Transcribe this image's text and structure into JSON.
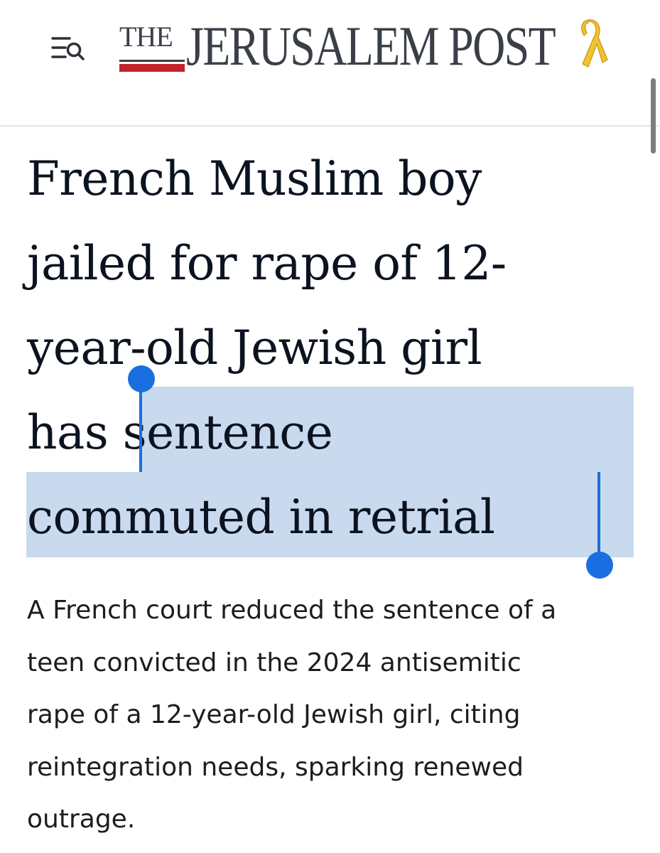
{
  "header": {
    "menu_icon": "menu-search-icon",
    "logo_the": "THE",
    "logo_name": "JERUSALEM POST",
    "ribbon_icon": "yellow-ribbon-icon",
    "ribbon_color": "#f2c230",
    "logo_accent_color": "#c3232a"
  },
  "article": {
    "headline_lines": [
      "French Muslim boy",
      "jailed for rape of 12-",
      "year-old Jewish girl",
      "has sentence",
      "commuted in retrial"
    ],
    "subhead_lines": [
      "A French court reduced the sentence of a",
      "teen convicted in the 2024 antisemitic",
      "rape of a 12-year-old Jewish girl, citing",
      "reintegration needs, sparking renewed",
      "outrage."
    ],
    "selected_text": "sentence commuted in retrial",
    "selection_color": "#c9daee",
    "caret_color": "#1a6fe0"
  }
}
